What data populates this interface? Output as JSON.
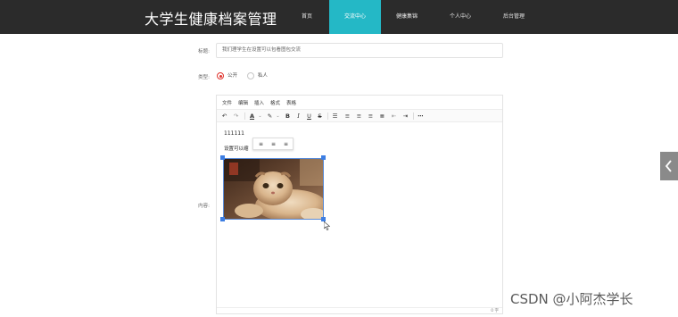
{
  "header": {
    "brand": "大学生健康档案管理",
    "nav": [
      "首页",
      "交流中心",
      "健康集锦",
      "个人中心",
      "后台管理"
    ],
    "active_index": 1
  },
  "form": {
    "title_label": "标题:",
    "title_value": "我们理学生在设置可以包看图包交流",
    "type_label": "类型:",
    "type_options": [
      "公开",
      "私人"
    ],
    "type_selected": "公开",
    "content_label": "内容:"
  },
  "editor": {
    "menus": [
      "文件",
      "编辑",
      "插入",
      "格式",
      "表格"
    ],
    "content_line1": "111111",
    "content_line2": "设置可以缩",
    "word_count": "0 字",
    "toolbar_icons": [
      "undo-icon",
      "redo-icon",
      "text-color-icon",
      "highlight-icon",
      "bold-icon",
      "italic-icon",
      "underline-icon",
      "strikethrough-icon",
      "list-icon",
      "align-left-icon",
      "align-center-icon",
      "align-right-icon",
      "align-justify-icon",
      "outdent-icon",
      "indent-icon",
      "more-icon"
    ]
  },
  "colors": {
    "header_bg": "#2b2b2b",
    "active_nav": "#24b8c6",
    "radio_checked": "#e0332d",
    "selection": "#3d7ee3"
  },
  "watermark": "CSDN @小阿杰学长"
}
